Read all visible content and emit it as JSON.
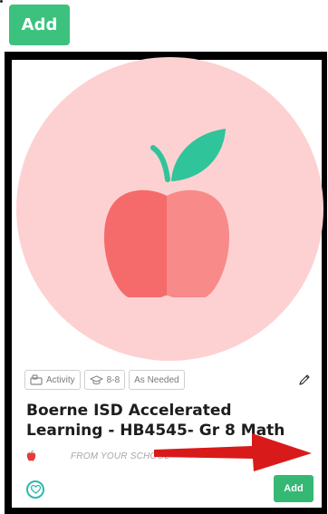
{
  "toolbar": {
    "add_label": "Add"
  },
  "card": {
    "tags": [
      {
        "label": "Activity",
        "icon": "activity-icon"
      },
      {
        "label": "8-8",
        "icon": "graduation-cap-icon"
      },
      {
        "label": "As Needed",
        "icon": ""
      }
    ],
    "title": "Boerne ISD Accelerated Learning - HB4545- Gr 8 Math",
    "source_label": "FROM YOUR SCHOOL",
    "add_label": "Add"
  },
  "colors": {
    "accent_green": "#3cc27e",
    "circle_pink": "#fdd1d2",
    "apple_red": "#f56b6b",
    "leaf_green": "#2fc49a",
    "arrow_red": "#d91a1a",
    "heart_teal": "#2fb8ac"
  }
}
